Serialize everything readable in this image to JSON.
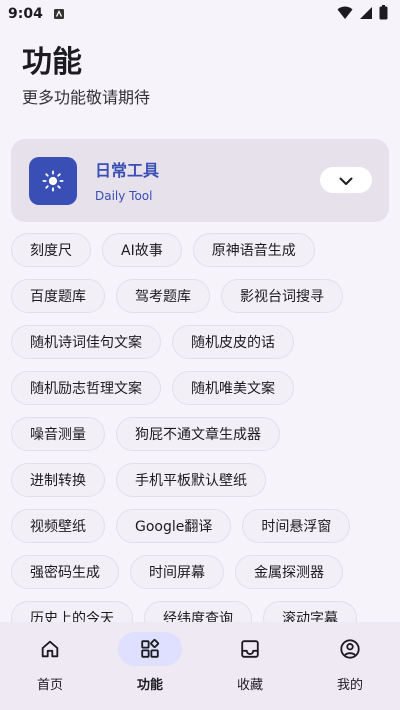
{
  "status": {
    "time": "9:04"
  },
  "header": {
    "title": "功能",
    "subtitle": "更多功能敬请期待"
  },
  "tool_card": {
    "title": "日常工具",
    "subtitle": "Daily Tool",
    "accent": "#3a4fb5"
  },
  "chips": [
    [
      "刻度尺",
      "AI故事",
      "原神语音生成"
    ],
    [
      "百度题库",
      "驾考题库",
      "影视台词搜寻"
    ],
    [
      "随机诗词佳句文案",
      "随机皮皮的话"
    ],
    [
      "随机励志哲理文案",
      "随机唯美文案"
    ],
    [
      "噪音测量",
      "狗屁不通文章生成器"
    ],
    [
      "进制转换",
      "手机平板默认壁纸"
    ],
    [
      "视频壁纸",
      "Google翻译",
      "时间悬浮窗"
    ],
    [
      "强密码生成",
      "时间屏幕",
      "金属探测器"
    ],
    [
      "历史上的今天",
      "经纬度查询",
      "滚动字幕"
    ]
  ],
  "nav": [
    {
      "label": "首页",
      "icon": "home-icon"
    },
    {
      "label": "功能",
      "icon": "apps-icon",
      "active": true
    },
    {
      "label": "收藏",
      "icon": "inbox-icon"
    },
    {
      "label": "我的",
      "icon": "account-icon"
    }
  ]
}
